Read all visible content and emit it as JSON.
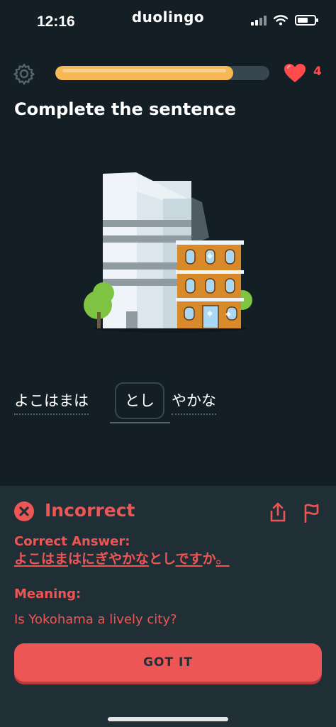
{
  "status_bar": {
    "time": "12:16",
    "brand": "duolingo"
  },
  "lesson": {
    "progress_fraction": 0.83,
    "hearts": "4",
    "prompt": "Complete the sentence"
  },
  "sentence": {
    "word_before": "よこはまは",
    "chip": "とし",
    "word_after": "やかな"
  },
  "feedback": {
    "title": "Incorrect",
    "correct_answer_label": "Correct Answer:",
    "answer_parts": [
      "よこはま",
      "は",
      "にぎやかな",
      "とし",
      "です",
      "か",
      "。"
    ],
    "meaning_label": "Meaning:",
    "meaning": "Is Yokohama a lively city?",
    "button": "GOT IT"
  },
  "colors": {
    "background": "#131f24",
    "panel": "#202f36",
    "accent_red": "#ee5555",
    "progress": "#f7b955",
    "heart": "#ff4b4b"
  }
}
